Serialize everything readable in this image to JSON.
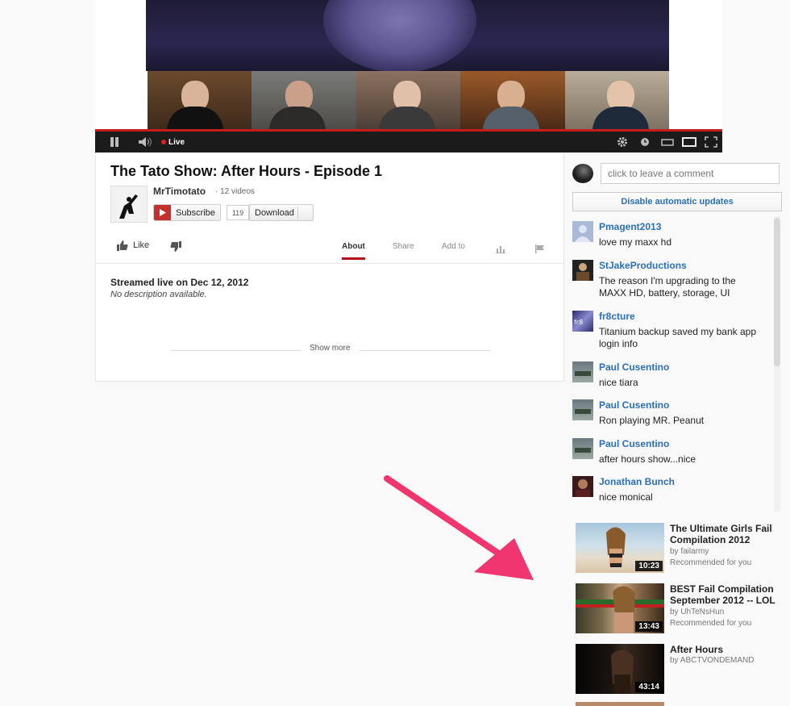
{
  "player": {
    "live_label": "Live",
    "icons": [
      "pause-icon",
      "volume-icon",
      "gear-icon",
      "clock-icon",
      "small-screen-icon",
      "large-screen-icon",
      "fullscreen-icon"
    ]
  },
  "video": {
    "title": "The Tato Show: After Hours - Episode 1",
    "channel_name": "MrTimotato",
    "channel_videos": "· 12 videos",
    "subscribe_label": "Subscribe",
    "subscriber_count": "119",
    "download_label": "Download",
    "like_label": "Like",
    "tabs": [
      "About",
      "Share",
      "Add to"
    ],
    "active_tab": "About",
    "streamed": "Streamed live on Dec 12, 2012",
    "description": "No description available.",
    "show_more": "Show more"
  },
  "comments": {
    "placeholder": "click to leave a comment",
    "disable_updates": "Disable automatic updates",
    "items": [
      {
        "author": "Pmagent2013",
        "text": "love my maxx hd"
      },
      {
        "author": "StJakeProductions",
        "text": "The reason I'm upgrading to the MAXX HD, battery, storage, UI"
      },
      {
        "author": "fr8cture",
        "text": "Titanium backup saved my bank app login info"
      },
      {
        "author": "Paul Cusentino",
        "text": "nice tiara"
      },
      {
        "author": "Paul Cusentino",
        "text": "Ron playing MR. Peanut"
      },
      {
        "author": "Paul Cusentino",
        "text": "after hours show...nice"
      },
      {
        "author": "Jonathan Bunch",
        "text": "nice monical"
      }
    ]
  },
  "recommendations": [
    {
      "title": "The Ultimate Girls Fail Compilation 2012",
      "by": "by failarmy",
      "note": "Recommended for you",
      "duration": "10:23"
    },
    {
      "title": "BEST Fail Compilation September 2012 -- LOL",
      "by": "by UhTeNsHun",
      "note": "Recommended for you",
      "duration": "13:43"
    },
    {
      "title": "After Hours",
      "by": "by ABCTVONDEMAND",
      "note": "",
      "duration": "43:14"
    }
  ],
  "colors": {
    "accent_red": "#c81d1d",
    "link_blue": "#2a6fb6",
    "annotation_pink": "#f0356f"
  }
}
